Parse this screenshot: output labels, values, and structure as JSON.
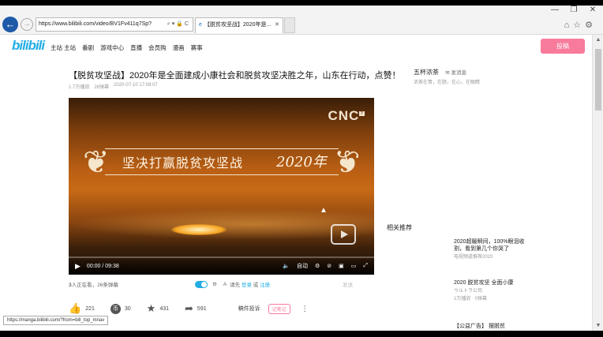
{
  "browser": {
    "url": "https://www.bilibili.com/video/BV1Fv411q7Sp?",
    "tab_title": "【脱贫攻坚战】2020年是..."
  },
  "site": {
    "logo": "bilibili",
    "nav": [
      "主站 主站",
      "番剧",
      "游戏中心",
      "直播",
      "会员购",
      "漫画",
      "赛事"
    ],
    "upload_label": "投稿"
  },
  "video": {
    "title": "【脱贫攻坚战】2020年是全面建成小康社会和脱贫攻坚决胜之年，山东在行动，点赞！",
    "views": "1.7万播放",
    "danmaku": "26弹幕",
    "date": "2020-07-10 17:08:07",
    "player": {
      "watermark": "CNC",
      "slogan": "坚决打赢脱贫攻坚战",
      "year": "2020年",
      "time": "00:00 / 09:38",
      "auto_label": "自动"
    },
    "live_viewers_count": "3",
    "live_viewers_text": "人正在看，26条弹幕",
    "danmaku_hint": "请先",
    "login_label": "登录",
    "or_label": "或",
    "register_label": "注册",
    "send_label": "发送",
    "likes": "221",
    "coins": "30",
    "favorites": "431",
    "shares": "591",
    "report_label": "稿件投诉",
    "note_label": "记笔记"
  },
  "author": {
    "name": "五杯浓茶",
    "message_label": "发消息",
    "desc": "浓茶在胃，在肠，在心，在眼睛"
  },
  "related": {
    "heading": "相关推荐",
    "items": [
      {
        "title": "2020超暖瞬间，100%眼泪收割，看到第几个你哭了",
        "by": "电视频道推荐2020"
      },
      {
        "title": "2020 脱贫攻坚 全面小康",
        "by": "ウルトラ公司",
        "stats": "1万播放 · 0弹幕"
      },
      {
        "title": "【公益广告】 摆脱贫"
      }
    ]
  },
  "status_url": "https://manga.bilibili.com/?from=bill_top_mnav"
}
